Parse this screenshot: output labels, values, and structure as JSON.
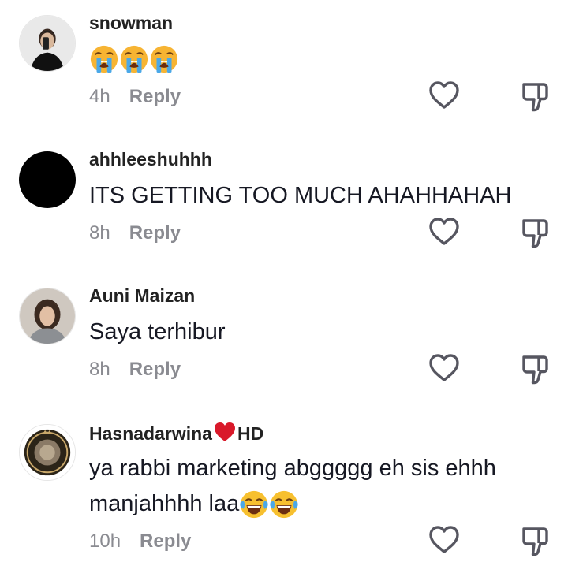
{
  "comments": [
    {
      "username": "snowman",
      "text": "",
      "emojis": [
        "loudly-crying-face",
        "loudly-crying-face",
        "loudly-crying-face"
      ],
      "time": "4h",
      "reply_label": "Reply"
    },
    {
      "username": "ahhleeshuhhh",
      "text": "ITS GETTING TOO MUCH AHAHHAHAH",
      "time": "8h",
      "reply_label": "Reply"
    },
    {
      "username": "Auni Maizan",
      "text": "Saya terhibur",
      "time": "8h",
      "reply_label": "Reply"
    },
    {
      "username_prefix": "Hasnadarwina",
      "username_suffix": "HD",
      "username_emoji": "red-heart",
      "text_line1": "ya rabbi marketing abggggg eh sis ehhh",
      "text_line2": "manjahhhh laa",
      "emojis": [
        "face-with-tears-of-joy",
        "face-with-tears-of-joy"
      ],
      "time": "10h",
      "reply_label": "Reply"
    }
  ],
  "icons": {
    "like": "heart-outline-icon",
    "dislike": "thumbs-down-outline-icon"
  },
  "colors": {
    "text": "#161823",
    "meta": "#8a8b91",
    "heart": "#e0202f"
  }
}
